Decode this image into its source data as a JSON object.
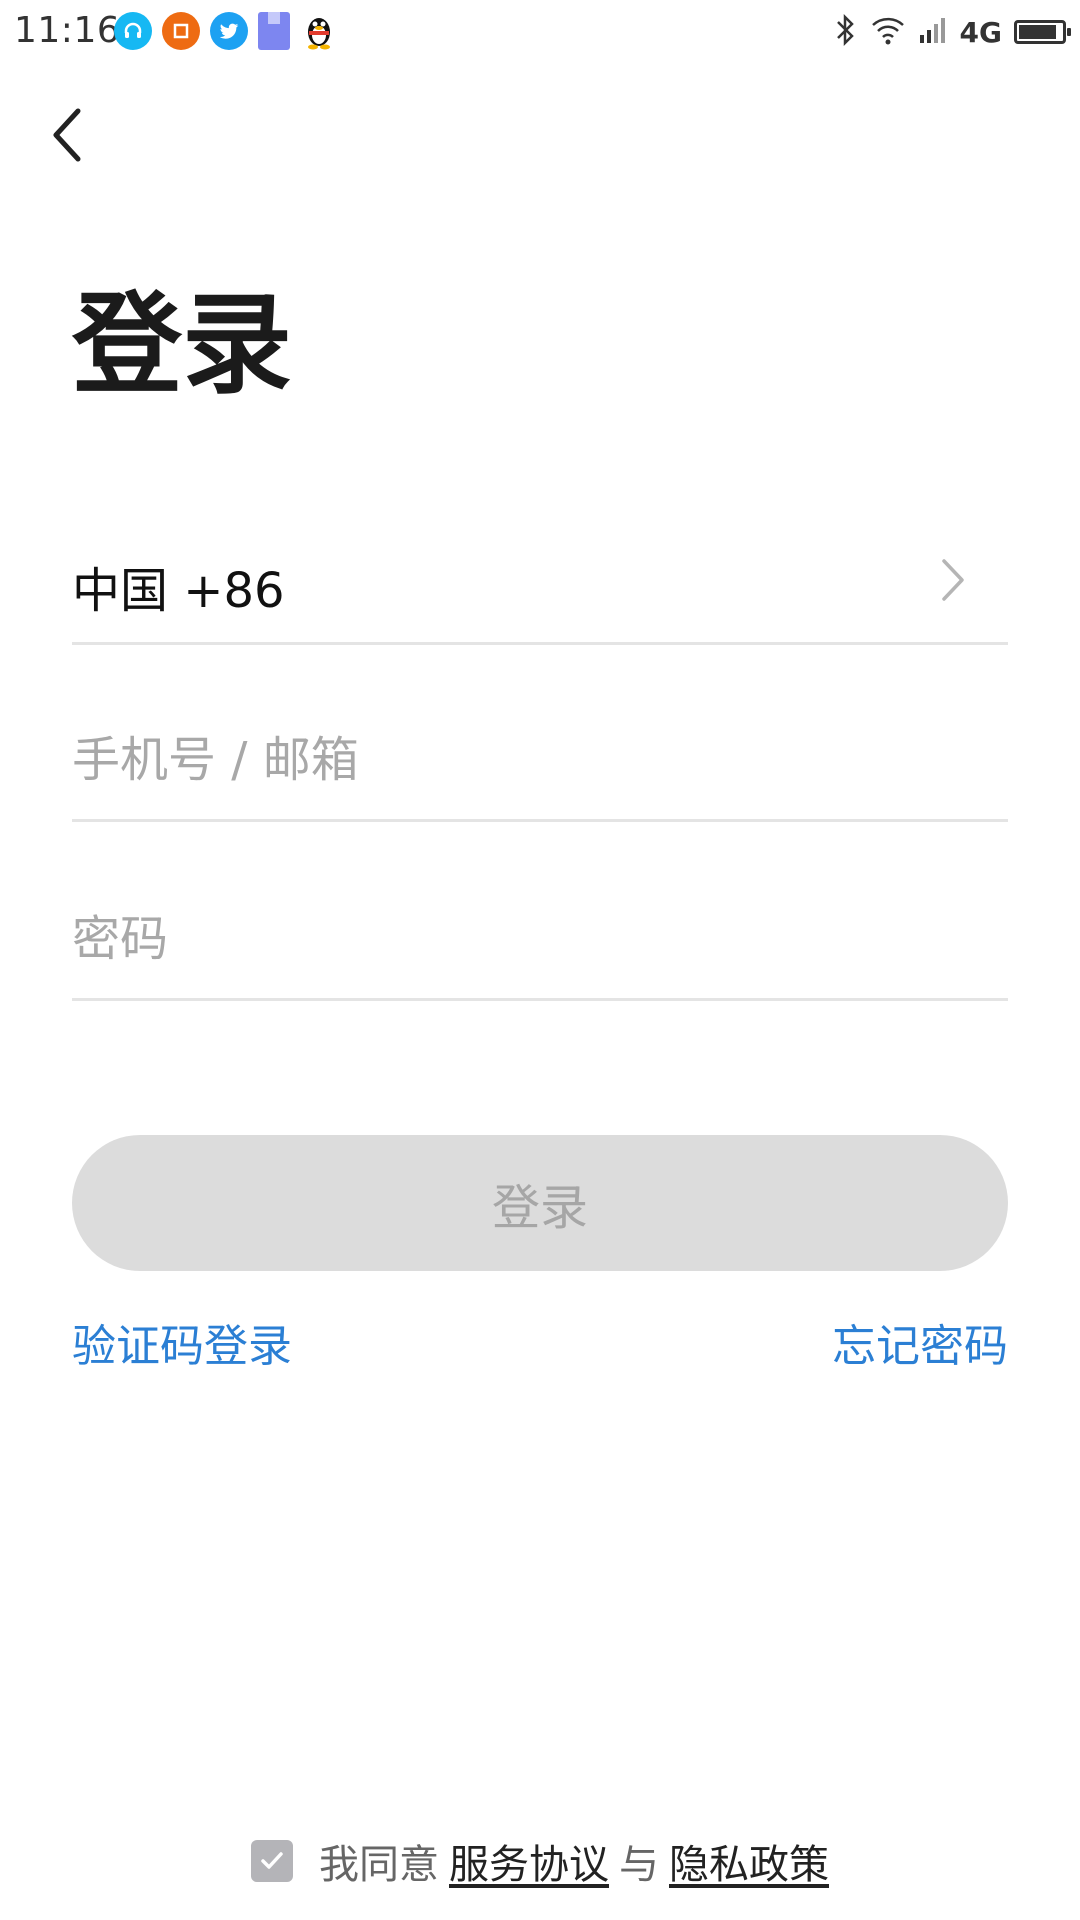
{
  "status_bar": {
    "time": "11:16",
    "network": "4G",
    "notification_icons": [
      "headset-icon",
      "orange-app-icon",
      "twitter-icon",
      "bookmark-icon",
      "qq-penguin-icon"
    ],
    "system_icons": [
      "bluetooth-icon",
      "wifi-icon",
      "signal-icon",
      "battery-icon"
    ]
  },
  "header": {
    "back_icon": "chevron-left-icon"
  },
  "title": "登录",
  "form": {
    "country": "中国 +86",
    "phone_placeholder": "手机号 / 邮箱",
    "password_placeholder": "密码"
  },
  "login_button": "登录",
  "links": {
    "sms_login": "验证码登录",
    "forgot_password": "忘记密码"
  },
  "agreement": {
    "checked": true,
    "prefix": "我同意",
    "service_terms": "服务协议",
    "conjunction": "与",
    "privacy_policy": "隐私政策"
  },
  "colors": {
    "link": "#2b7fd4",
    "button_disabled_bg": "#dcdcdc",
    "divider": "#e4e4e4"
  }
}
